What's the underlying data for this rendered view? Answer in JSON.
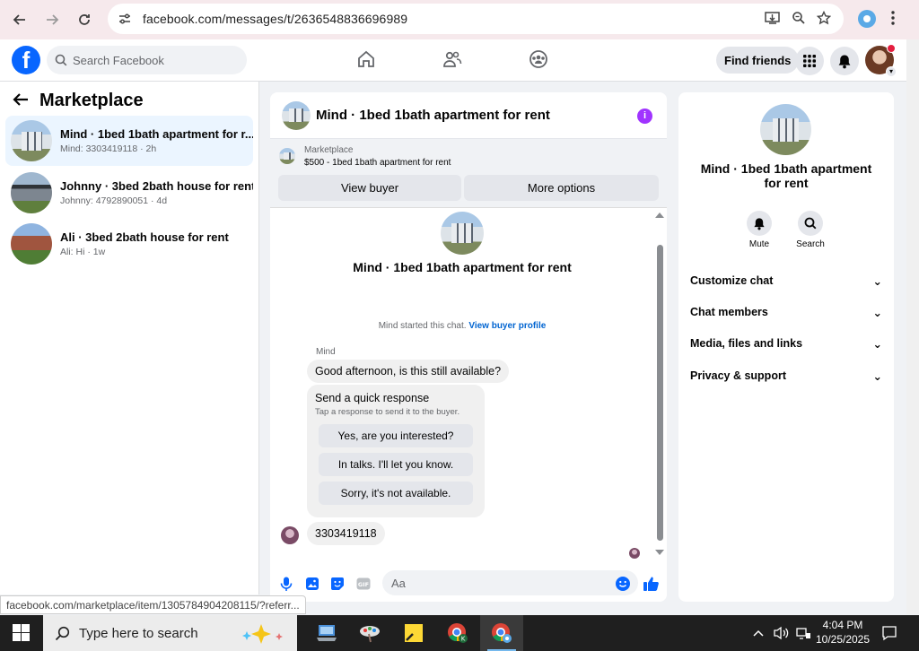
{
  "browser": {
    "url": "facebook.com/messages/t/2636548836696989"
  },
  "fb": {
    "search_placeholder": "Search Facebook",
    "find_friends": "Find friends"
  },
  "left": {
    "title": "Marketplace",
    "conversations": [
      {
        "title": "Mind · 1bed 1bath apartment for r...",
        "preview": "Mind: 3303419118 · 2h"
      },
      {
        "title": "Johnny · 3bed 2bath house for rent",
        "preview": "Johnny: 4792890051 · 4d"
      },
      {
        "title": "Ali · 3bed 2bath house for rent",
        "preview": "Ali: Hi · 1w"
      }
    ]
  },
  "chat": {
    "title": "Mind · 1bed 1bath apartment for rent",
    "marketplace_label": "Marketplace",
    "listing": "$500 - 1bed 1bath apartment for rent",
    "view_buyer": "View buyer",
    "more_options": "More options",
    "conversation_title": "Mind · 1bed 1bath apartment for rent",
    "started_text": "Mind started this chat.",
    "view_buyer_profile": "View buyer profile",
    "sender": "Mind",
    "message1": "Good afternoon, is this still available?",
    "quick_title": "Send a quick response",
    "quick_sub": "Tap a response to send it to the buyer.",
    "quick_responses": [
      "Yes, are you interested?",
      "In talks. I'll let you know.",
      "Sorry, it's not available."
    ],
    "message2": "3303419118",
    "composer_placeholder": "Aa"
  },
  "right": {
    "name": "Mind · 1bed 1bath apartment for rent",
    "mute": "Mute",
    "search": "Search",
    "sections": [
      "Customize chat",
      "Chat members",
      "Media, files and links",
      "Privacy & support"
    ]
  },
  "status_url": "facebook.com/marketplace/item/1305784904208115/?referr...",
  "taskbar": {
    "search_placeholder": "Type here to search",
    "time": "4:04 PM",
    "date": "10/25/2025"
  },
  "colors": {
    "fb_blue": "#0866ff",
    "active_row": "#ebf5ff",
    "info_purple": "#a033ff",
    "link": "#0064d1"
  }
}
